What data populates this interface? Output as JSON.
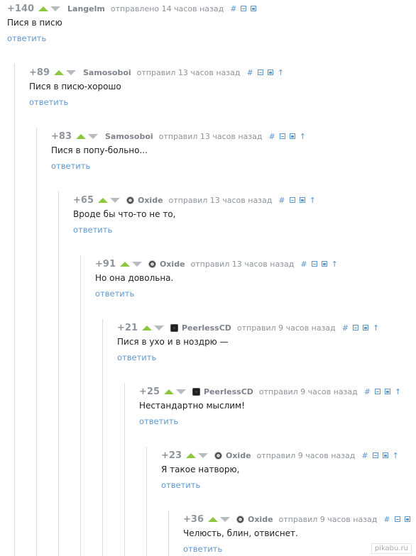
{
  "icons": {
    "permalink": "#",
    "collapse": "minus-box-icon",
    "save": "save-icon",
    "parent": "↑"
  },
  "colors": {
    "accent_link": "#5c97d0",
    "upvote": "#8dc63f",
    "downvote": "#b7bcc2"
  },
  "comments": [
    {
      "score": "+140",
      "user": "Langelm",
      "avatar": "",
      "action_time": "отправлено 14 часов назад",
      "text": "Пися в писю",
      "reply": "ответить"
    },
    {
      "score": "+89",
      "user": "Samosoboi",
      "avatar": "",
      "action_time": "отправил 13 часов назад",
      "text": "Пися в писю-хорошо",
      "reply": "ответить"
    },
    {
      "score": "+83",
      "user": "Samosoboi",
      "avatar": "",
      "action_time": "отправил 13 часов назад",
      "text": "Пися в попу-больно...",
      "reply": "ответить"
    },
    {
      "score": "+65",
      "user": "Oxide",
      "avatar": "round",
      "action_time": "отправил 13 часов назад",
      "text": "Вроде бы что-то не то,",
      "reply": "ответить"
    },
    {
      "score": "+91",
      "user": "Oxide",
      "avatar": "round",
      "action_time": "отправил 13 часов назад",
      "text": "Но она довольна.",
      "reply": "ответить"
    },
    {
      "score": "+21",
      "user": "PeerlessCD",
      "avatar": "square",
      "action_time": "отправил 9 часов назад",
      "text": "Пися в ухо и в ноздрю —",
      "reply": "ответить"
    },
    {
      "score": "+25",
      "user": "PeerlessCD",
      "avatar": "square",
      "action_time": "отправил 9 часов назад",
      "text": "Нестандартно мыслим!",
      "reply": "ответить"
    },
    {
      "score": "+23",
      "user": "Oxide",
      "avatar": "round",
      "action_time": "отправил 9 часов назад",
      "text": "Я такое натворю,",
      "reply": "ответить"
    },
    {
      "score": "+36",
      "user": "Oxide",
      "avatar": "round",
      "action_time": "отправил 9 часов назад",
      "text": "Челюсть, блин, отвиснет.",
      "reply": "ответить"
    }
  ],
  "watermark": "pikabu.ru"
}
